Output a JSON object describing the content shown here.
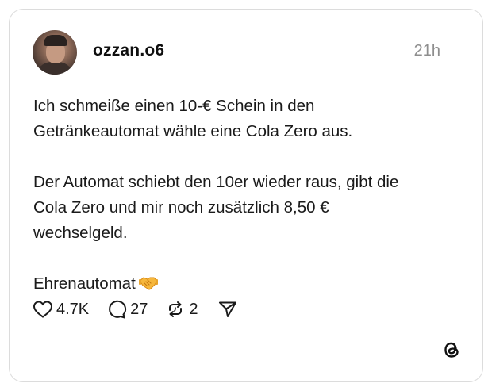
{
  "post": {
    "username": "ozzan.o6",
    "timestamp": "21h",
    "paragraphs": [
      "Ich schmeiße einen 10-€ Schein in den\nGetränkeautomat wähle eine Cola Zero aus.",
      "Der Automat schiebt den 10er wieder raus, gibt die\nCola Zero und mir noch zusätzlich 8,50 €\nwechselgeld.",
      "Ehrenautomat"
    ],
    "closing_emoji_icon": "handshake-emoji"
  },
  "actions": {
    "likes": "4.7K",
    "comments": "27",
    "reposts": "2",
    "like_icon": "heart-icon",
    "comment_icon": "comment-icon",
    "repost_icon": "repost-icon",
    "share_icon": "send-icon"
  },
  "brand": {
    "logo_icon": "threads-logo-icon"
  }
}
